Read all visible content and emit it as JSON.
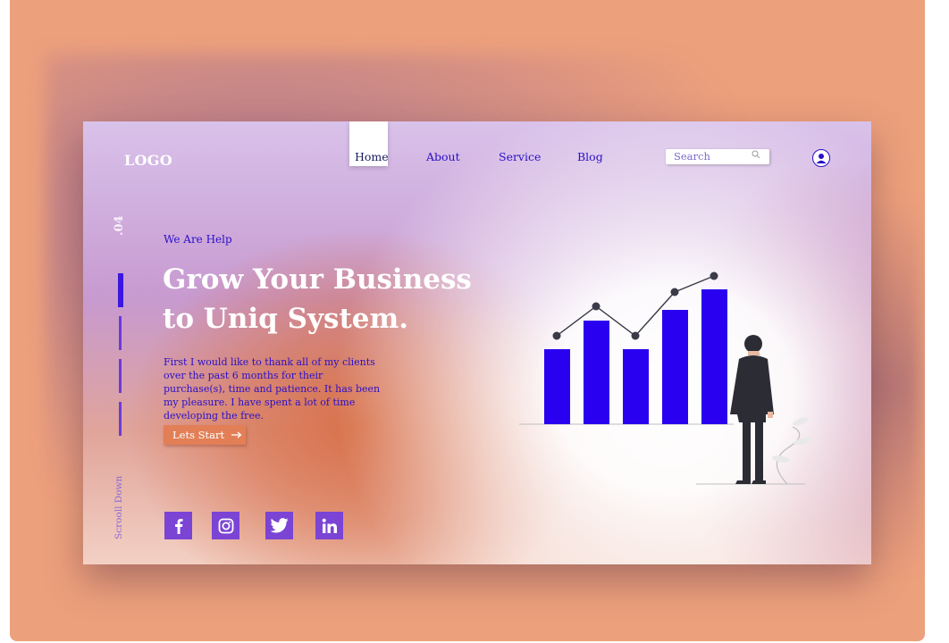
{
  "brand": {
    "logo": "LOGO"
  },
  "nav": {
    "items": [
      {
        "label": "Home",
        "active": true
      },
      {
        "label": "About"
      },
      {
        "label": "Service"
      },
      {
        "label": "Blog"
      }
    ]
  },
  "search": {
    "placeholder": "Search",
    "icon": "search-icon"
  },
  "user": {
    "icon": "user-icon"
  },
  "side": {
    "slide_number": ".04",
    "scroll_label": "Scrooll Down"
  },
  "hero": {
    "eyebrow": "We Are Help",
    "headline_line1": "Grow Your Business",
    "headline_line2": "to Uniq System.",
    "body": "First I would like to thank all of my clients over the past 6 months for their purchase(s), time and patience. It has been my pleasure. I have spent a lot of time developing the free.",
    "cta_label": "Lets Start",
    "cta_icon": "arrow-right-icon"
  },
  "social": [
    {
      "name": "facebook-icon"
    },
    {
      "name": "instagram-icon"
    },
    {
      "name": "twitter-icon"
    },
    {
      "name": "linkedin-icon"
    }
  ],
  "colors": {
    "background": "#eda07c",
    "accent_blue": "#2a10c8",
    "bar_blue": "#2a00f0",
    "purple": "#7b44d4",
    "cta": "#e27f57"
  }
}
